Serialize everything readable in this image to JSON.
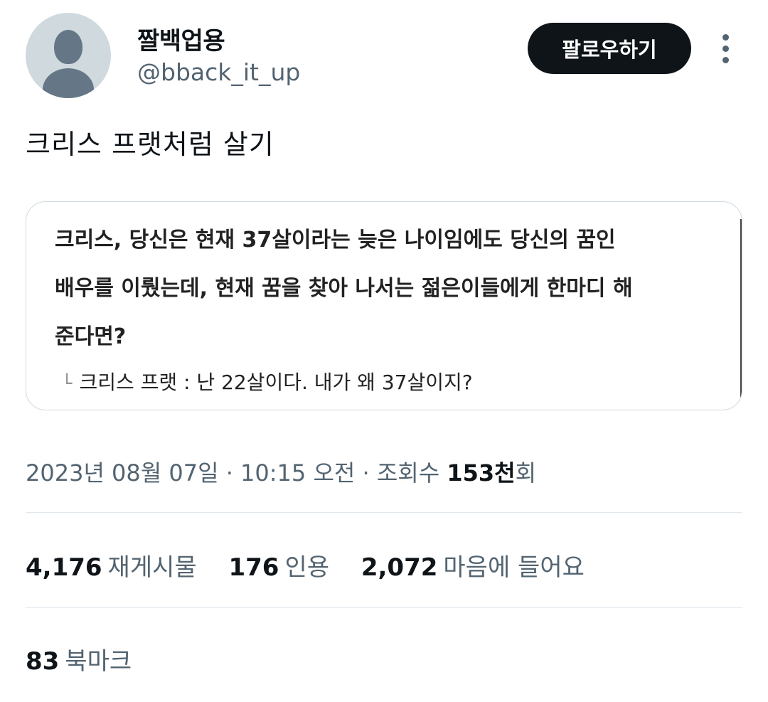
{
  "user": {
    "name": "짤백업용",
    "handle": "@bback_it_up",
    "follow_label": "팔로우하기"
  },
  "tweet": {
    "text": "크리스 프랫처럼 살기"
  },
  "media": {
    "lines": [
      "크리스, 당신은 현재 37살이라는 늦은 나이임에도 당신의 꿈인",
      "배우를 이뤘는데, 현재 꿈을 찾아 나서는 젊은이들에게 한마디 해",
      "준다면?"
    ],
    "reply_marker": "└",
    "reply": "크리스 프랫 : 난 22살이다. 내가 왜 37살이지?"
  },
  "meta": {
    "date_time": "2023년 08월 07일 · 10:15 오전 · 조회수 ",
    "views_count": "153천",
    "views_unit": "회"
  },
  "stats": {
    "retweets": {
      "count": "4,176",
      "label": "재게시물"
    },
    "quotes": {
      "count": "176",
      "label": "인용"
    },
    "likes": {
      "count": "2,072",
      "label": "마음에 들어요"
    },
    "bookmarks": {
      "count": "83",
      "label": "북마크"
    }
  },
  "icons": {
    "avatar": "default-avatar-icon",
    "more": "more-dots-icon"
  }
}
